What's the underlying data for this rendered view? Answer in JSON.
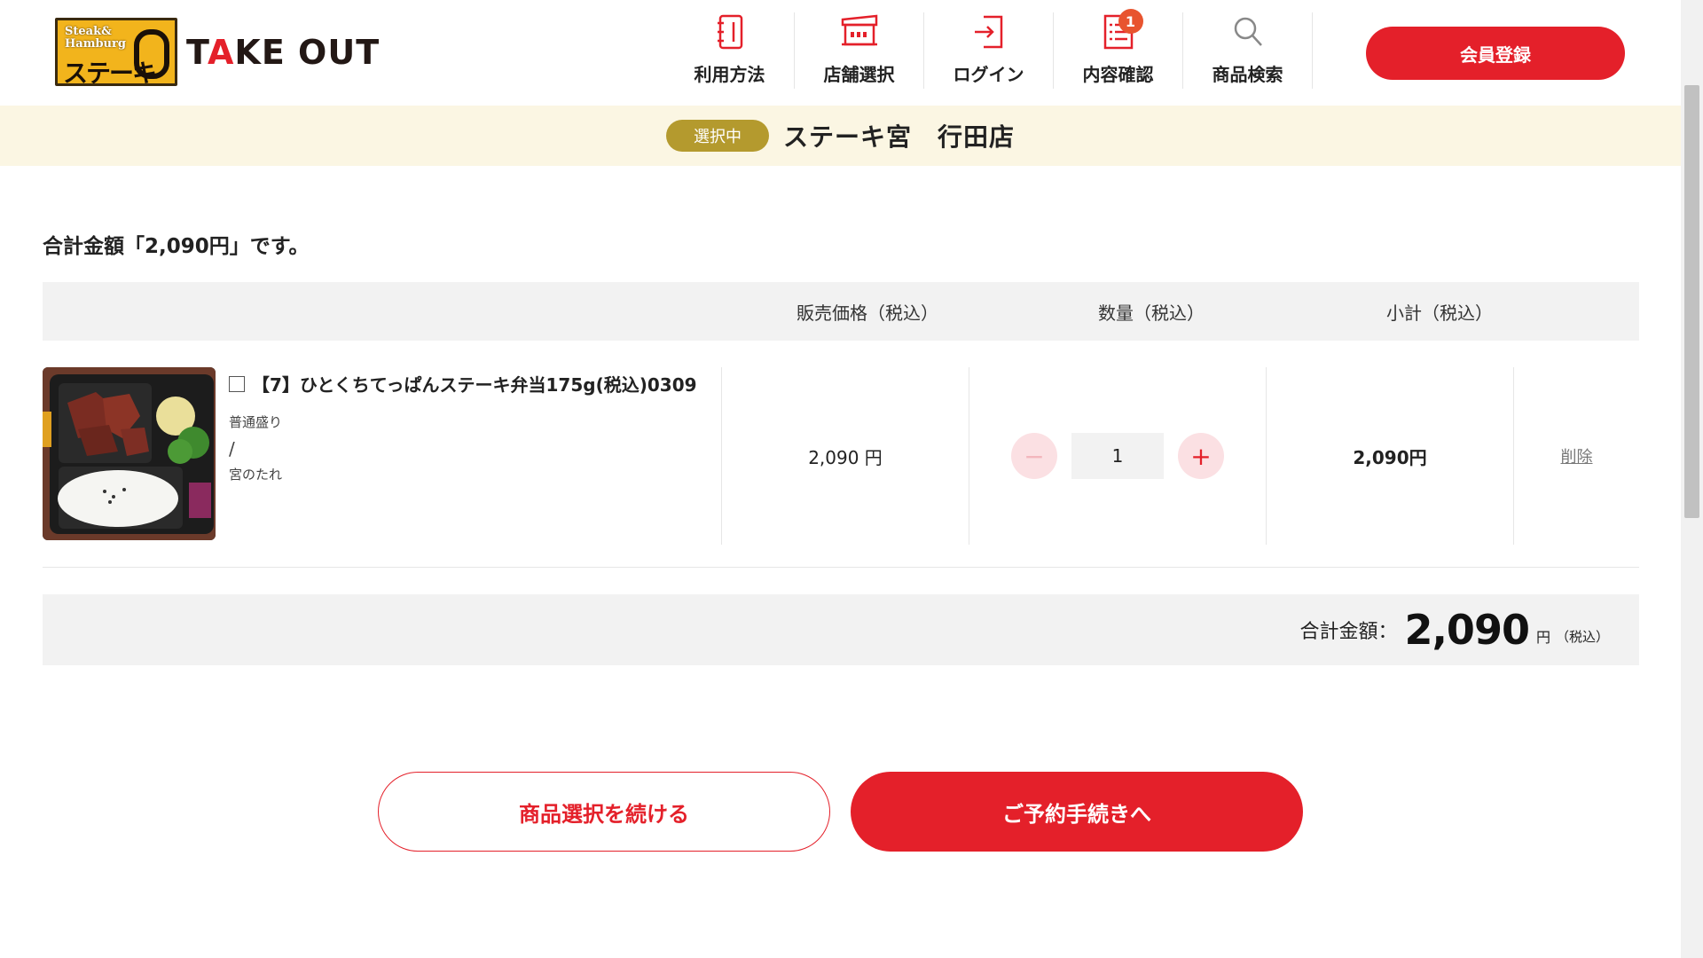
{
  "brand": {
    "logo_line1": "Steak&",
    "logo_line2": "Hamburg",
    "logo_jp": "ステーキ",
    "takeout_t": "T",
    "takeout_a": "A",
    "takeout_rest": "KE OUT"
  },
  "nav": {
    "items": [
      {
        "label": "利用方法",
        "icon": "guide-book-icon"
      },
      {
        "label": "店舗選択",
        "icon": "store-icon"
      },
      {
        "label": "ログイン",
        "icon": "login-icon"
      },
      {
        "label": "内容確認",
        "icon": "cart-list-icon",
        "badge": "1"
      },
      {
        "label": "商品検索",
        "icon": "search-icon"
      }
    ],
    "member_button": "会員登録"
  },
  "store": {
    "pill": "選択中",
    "name": "ステーキ宮　行田店"
  },
  "summary": {
    "message": "合計金額「2,090円」です。"
  },
  "table": {
    "headers": {
      "price": "販売価格（税込）",
      "quantity": "数量（税込）",
      "subtotal": "小計（税込）"
    },
    "row": {
      "title": "【7】ひとくちてっぱんステーキ弁当175g(税込)0309",
      "option1": "普通盛り",
      "separator": "/",
      "option2": "宮のたれ",
      "price": "2,090 円",
      "quantity": "1",
      "minus": "−",
      "plus": "+",
      "subtotal": "2,090円",
      "delete": "削除"
    }
  },
  "total": {
    "label": "合計金額：",
    "amount": "2,090",
    "unit": "円",
    "tax": "（税込）"
  },
  "actions": {
    "continue": "商品選択を続ける",
    "reserve": "ご予約手続きへ"
  },
  "colors": {
    "accent": "#e4202a",
    "store_bar": "#fbf6e3",
    "pill": "#b49a2e",
    "badge": "#e8542f"
  }
}
